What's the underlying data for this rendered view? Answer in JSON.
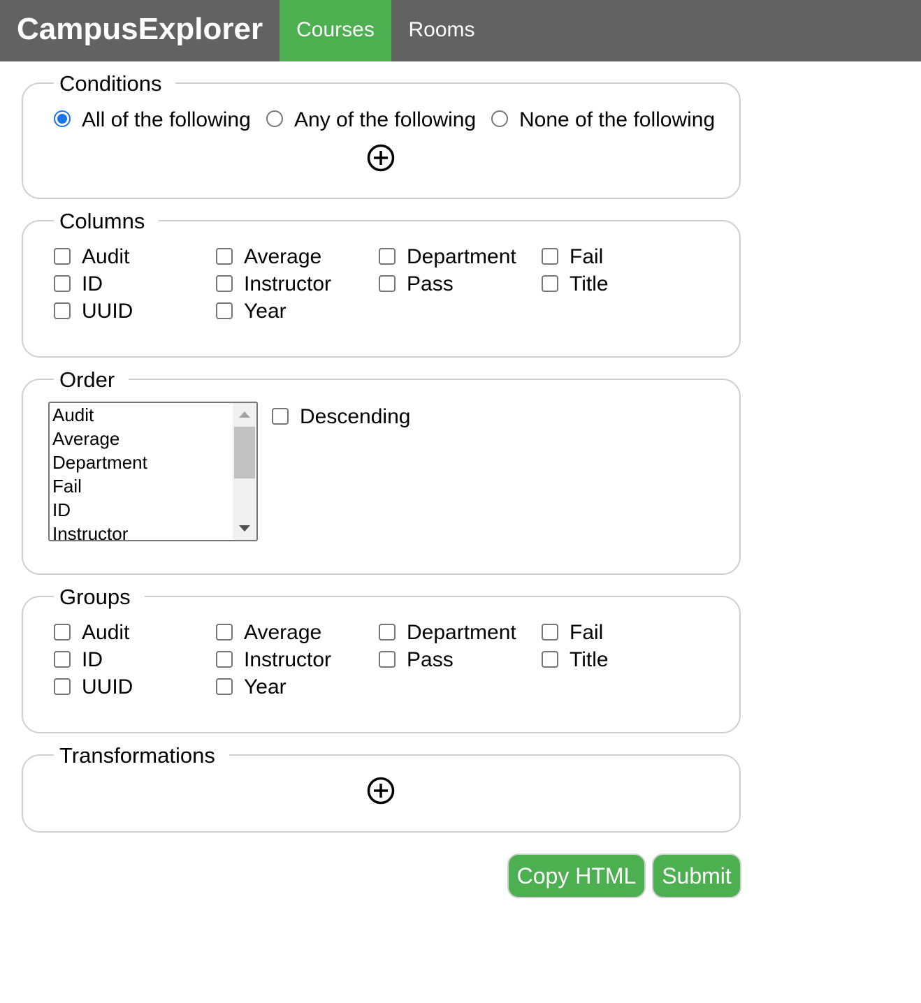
{
  "nav": {
    "brand": "CampusExplorer",
    "tabs": [
      {
        "label": "Courses",
        "active": true
      },
      {
        "label": "Rooms",
        "active": false
      }
    ],
    "colors": {
      "bar": "#626262",
      "active_tab": "#4caf50"
    }
  },
  "conditions": {
    "legend": "Conditions",
    "options": [
      {
        "label": "All of the following",
        "checked": true
      },
      {
        "label": "Any of the following",
        "checked": false
      },
      {
        "label": "None of the following",
        "checked": false
      }
    ],
    "add_icon": "plus-circle-icon"
  },
  "columns": {
    "legend": "Columns",
    "fields": [
      "Audit",
      "Average",
      "Department",
      "Fail",
      "ID",
      "Instructor",
      "Pass",
      "Title",
      "UUID",
      "Year"
    ]
  },
  "order": {
    "legend": "Order",
    "options": [
      "Audit",
      "Average",
      "Department",
      "Fail",
      "ID",
      "Instructor"
    ],
    "descending_label": "Descending"
  },
  "groups": {
    "legend": "Groups",
    "fields": [
      "Audit",
      "Average",
      "Department",
      "Fail",
      "ID",
      "Instructor",
      "Pass",
      "Title",
      "UUID",
      "Year"
    ]
  },
  "transformations": {
    "legend": "Transformations",
    "add_icon": "plus-circle-icon"
  },
  "actions": {
    "copy_label": "Copy HTML",
    "submit_label": "Submit",
    "color": "#4caf50"
  }
}
